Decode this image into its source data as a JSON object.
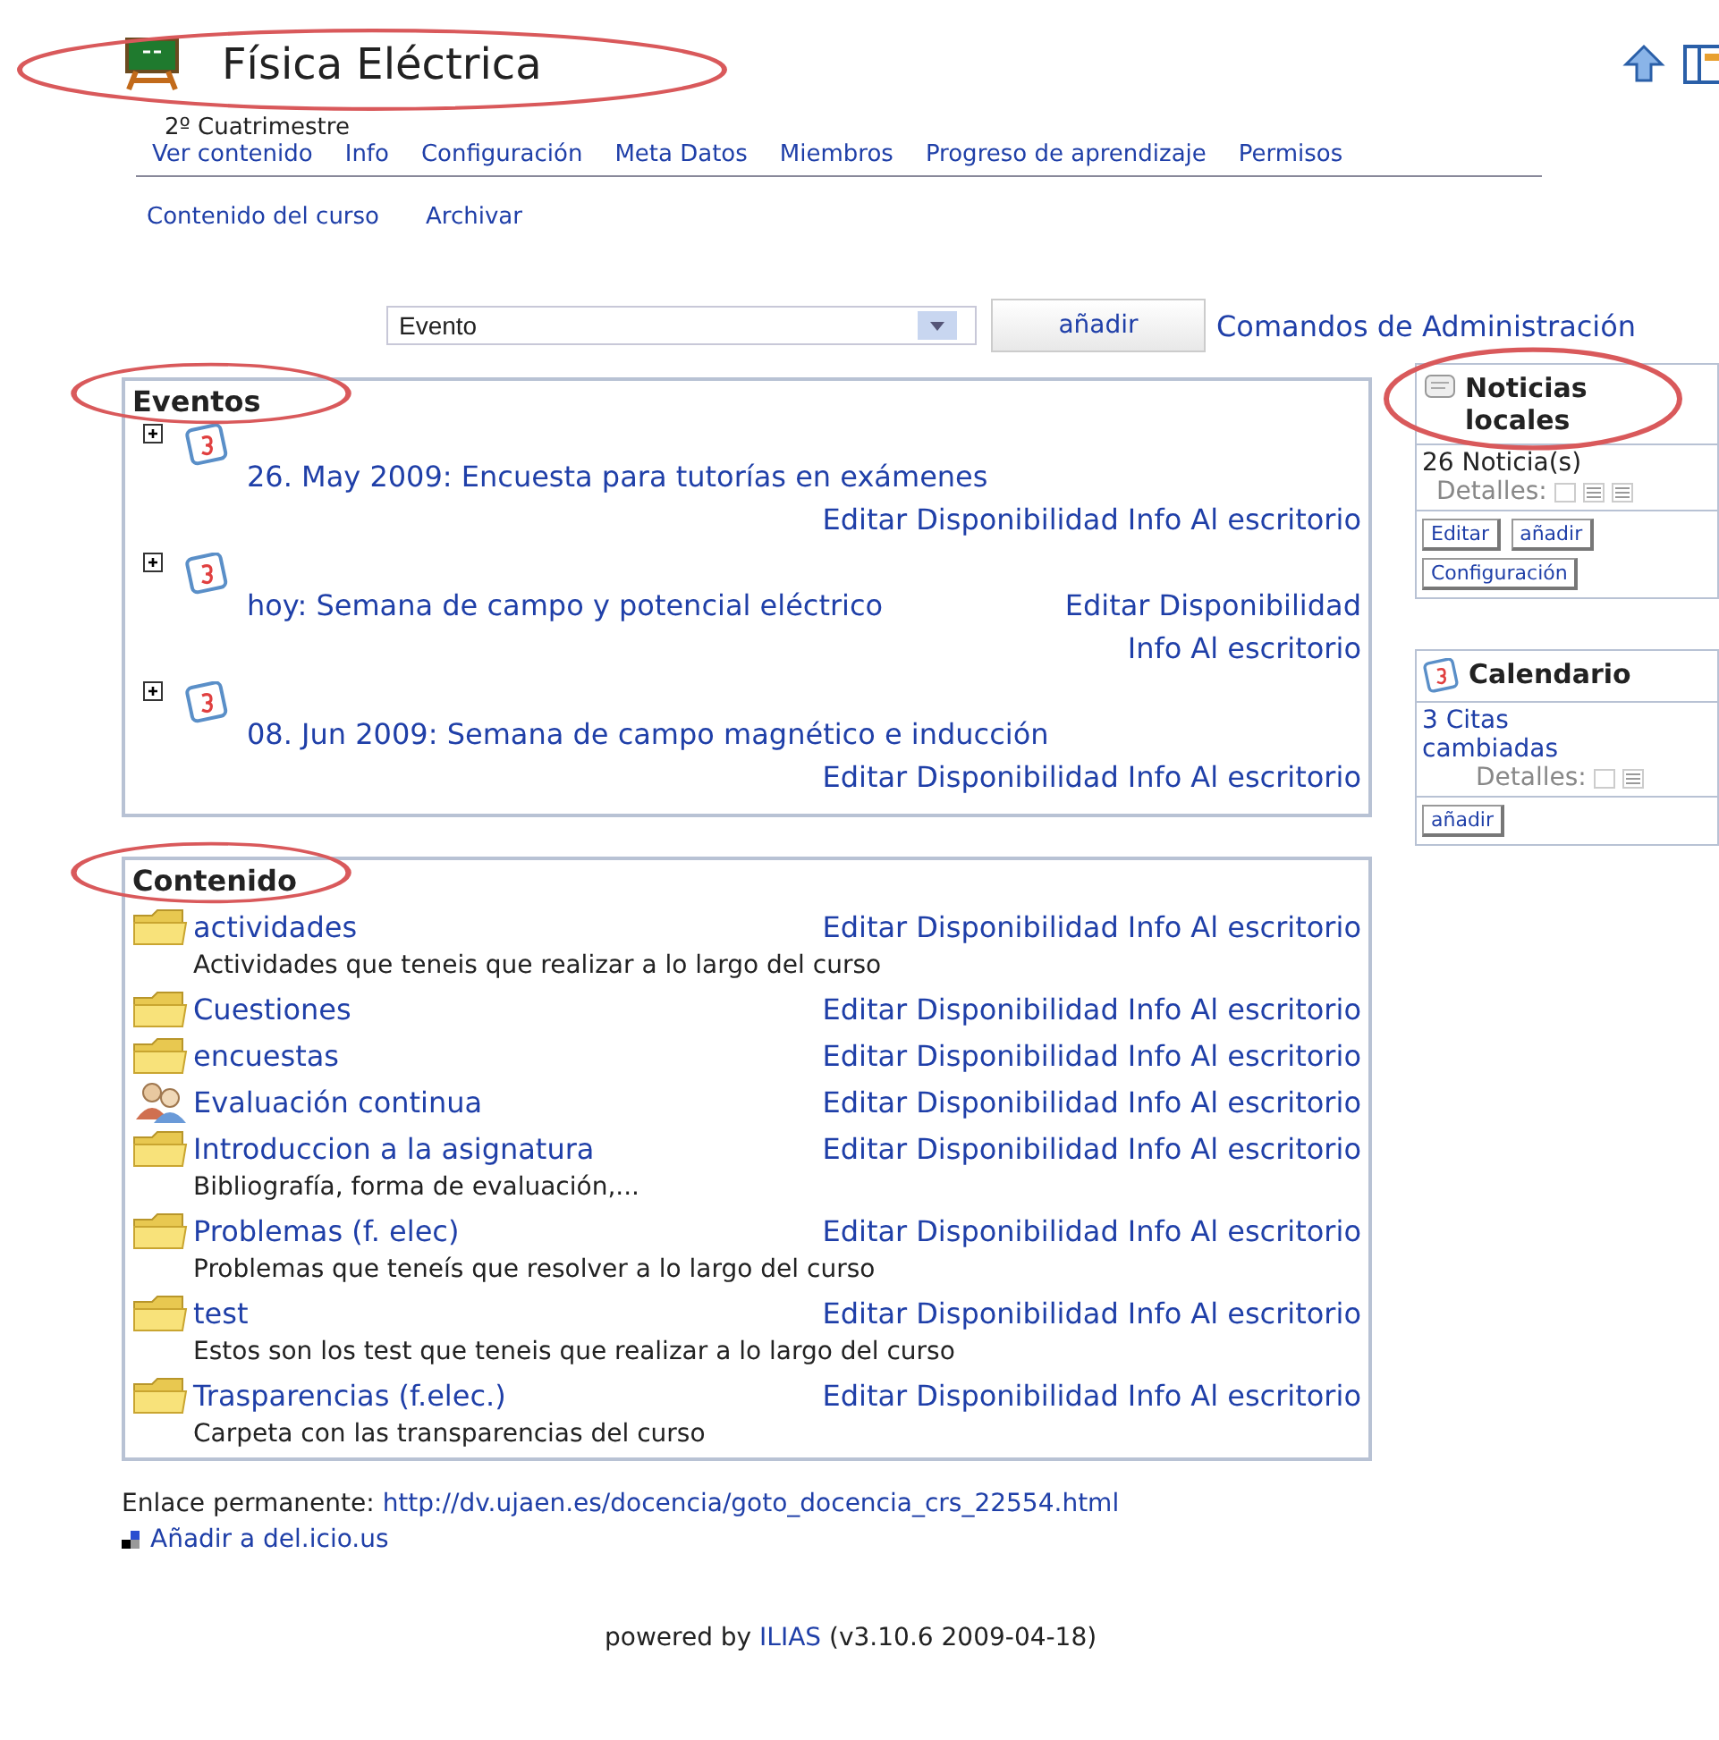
{
  "header": {
    "title": "Física Eléctrica",
    "highlighted": true,
    "subtitle": "2º Cuatrimestre"
  },
  "tabs": [
    {
      "label": "Ver contenido",
      "selected": false
    },
    {
      "label": "Info",
      "selected": false
    },
    {
      "label": "Configuración",
      "selected": false
    },
    {
      "label": "Meta Datos",
      "selected": false
    },
    {
      "label": "Miembros",
      "selected": false
    },
    {
      "label": "Progreso de aprendizaje",
      "selected": false
    },
    {
      "label": "Permisos",
      "selected": false
    }
  ],
  "subtabs": [
    "Contenido del curso",
    "Archivar"
  ],
  "add_bar": {
    "select_value": "Evento",
    "button": "añadir",
    "link": "Comandos de Administración"
  },
  "events": {
    "title": "Eventos",
    "highlighted": true,
    "items": [
      {
        "title": "26. May 2009: Encuesta para tutorías en exámenes",
        "actions": [
          "Editar",
          "Disponibilidad",
          "Info",
          "Al escritorio"
        ]
      },
      {
        "title": "hoy: Semana de campo y potencial eléctrico",
        "actions": [
          "Editar",
          "Disponibilidad",
          "Info",
          "Al escritorio"
        ]
      },
      {
        "title": "08. Jun 2009: Semana de campo magnético e inducción",
        "actions": [
          "Editar",
          "Disponibilidad",
          "Info",
          "Al escritorio"
        ]
      }
    ]
  },
  "content": {
    "title": "Contenido",
    "highlighted": true,
    "items": [
      {
        "kind": "folder",
        "title": "actividades",
        "actions": [
          "Editar",
          "Disponibilidad",
          "Info",
          "Al escritorio"
        ],
        "description": "Actividades que teneis que realizar a lo largo del curso"
      },
      {
        "kind": "folder",
        "title": "Cuestiones",
        "actions": [
          "Editar",
          "Disponibilidad",
          "Info",
          "Al escritorio"
        ]
      },
      {
        "kind": "folder",
        "title": "encuestas",
        "actions": [
          "Editar",
          "Disponibilidad",
          "Info",
          "Al escritorio"
        ]
      },
      {
        "kind": "group",
        "title": "Evaluación continua",
        "actions": [
          "Editar",
          "Disponibilidad",
          "Info",
          "Al escritorio"
        ]
      },
      {
        "kind": "folder",
        "title": "Introduccion a la asignatura",
        "actions": [
          "Editar",
          "Disponibilidad",
          "Info",
          "Al escritorio"
        ],
        "description": "Bibliografía, forma de evaluación,..."
      },
      {
        "kind": "folder",
        "title": "Problemas (f. elec)",
        "actions": [
          "Editar",
          "Disponibilidad",
          "Info",
          "Al escritorio"
        ],
        "description": "Problemas que teneís que resolver a lo largo del curso"
      },
      {
        "kind": "folder",
        "title": "test",
        "actions": [
          "Editar",
          "Disponibilidad",
          "Info",
          "Al escritorio"
        ],
        "description": "Estos son los test que teneis que realizar a lo largo del curso"
      },
      {
        "kind": "folder",
        "title": "Trasparencias (f.elec.)",
        "actions": [
          "Editar",
          "Disponibilidad",
          "Info",
          "Al escritorio"
        ],
        "description": "Carpeta con las transparencias del curso"
      }
    ]
  },
  "news": {
    "title": "Noticias locales",
    "highlighted": true,
    "count": "26 Noticia(s)",
    "details_label": "Detalles:",
    "buttons": [
      "Editar",
      "añadir",
      "Configuración"
    ]
  },
  "calendar": {
    "title": "Calendario",
    "link": "3 Citas cambiadas",
    "details_label": "Detalles:",
    "buttons": [
      "añadir"
    ]
  },
  "footer": {
    "permalink_label": "Enlace permanente:",
    "permalink": "http://dv.ujaen.es/docencia/goto_docencia_crs_22554.html",
    "bookmark": "Añadir a del.icio.us",
    "powered_prefix": "powered by",
    "powered_link": "ILIAS",
    "powered_suffix": "(v3.10.6 2009-04-18)"
  }
}
